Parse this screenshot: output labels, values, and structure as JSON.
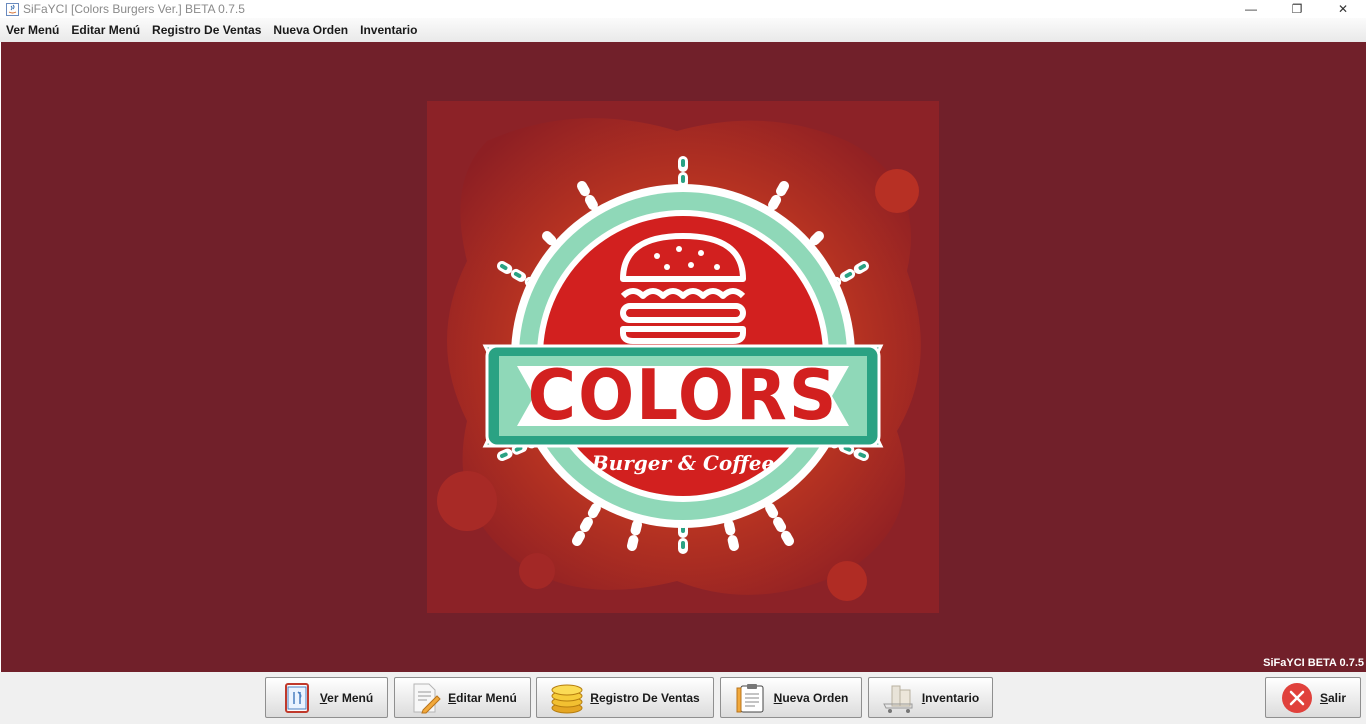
{
  "window": {
    "title": "SiFaYCI [Colors Burgers Ver.] BETA 0.7.5",
    "minimize_glyph": "—",
    "restore_glyph": "❐",
    "close_glyph": "✕"
  },
  "menubar": {
    "items": [
      {
        "label": "Ver Menú"
      },
      {
        "label": "Editar Menú"
      },
      {
        "label": "Registro De Ventas"
      },
      {
        "label": "Nueva Orden"
      },
      {
        "label": "Inventario"
      }
    ]
  },
  "logo": {
    "title": "COLORS",
    "subtitle": "Burger & Coffee"
  },
  "version_label": "SiFaYCI BETA 0.7.5",
  "toolbar": {
    "ver_menu": "Ver Menú",
    "editar_menu": "Editar Menú",
    "registro_ventas": "Registro De Ventas",
    "nueva_orden": "Nueva Orden",
    "inventario": "Inventario",
    "salir": "Salir"
  },
  "icons": {
    "ver_menu": "menu-card-icon",
    "editar_menu": "document-pencil-icon",
    "registro_ventas": "coins-icon",
    "nueva_orden": "clipboard-pencil-icon",
    "inventario": "warehouse-cart-icon",
    "salir": "close-circle-icon"
  },
  "colors": {
    "background": "#71202a",
    "logo_red": "#d2201f",
    "logo_mint": "#8fd8b8",
    "logo_teal": "#2aa283",
    "exit_red": "#e0413c"
  }
}
